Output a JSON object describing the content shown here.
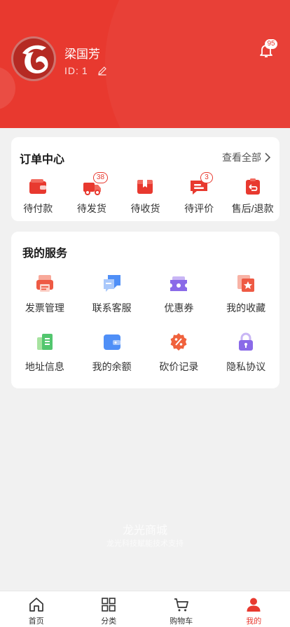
{
  "user": {
    "name": "梁国芳",
    "id_label": "ID:",
    "id_value": "1",
    "notification_count": "95"
  },
  "order_center": {
    "title": "订单中心",
    "view_all": "查看全部",
    "items": [
      {
        "label": "待付款",
        "icon": "wallet-icon",
        "badge": ""
      },
      {
        "label": "待发货",
        "icon": "delivery-truck-icon",
        "badge": "38"
      },
      {
        "label": "待收货",
        "icon": "package-box-icon",
        "badge": ""
      },
      {
        "label": "待评价",
        "icon": "review-message-icon",
        "badge": "3"
      },
      {
        "label": "售后/退款",
        "icon": "refund-clipboard-icon",
        "badge": ""
      }
    ]
  },
  "services": {
    "title": "我的服务",
    "items": [
      {
        "label": "发票管理",
        "icon": "invoice-printer-icon"
      },
      {
        "label": "联系客服",
        "icon": "customer-service-chat-icon"
      },
      {
        "label": "优惠券",
        "icon": "coupon-ticket-icon"
      },
      {
        "label": "我的收藏",
        "icon": "favorites-star-icon"
      },
      {
        "label": "地址信息",
        "icon": "address-document-icon"
      },
      {
        "label": "我的余额",
        "icon": "balance-card-icon"
      },
      {
        "label": "砍价记录",
        "icon": "bargain-percent-icon"
      },
      {
        "label": "隐私协议",
        "icon": "privacy-lock-icon"
      }
    ]
  },
  "watermark": {
    "line1": "龙光商城",
    "line2": "龙光科技赋能技术支持"
  },
  "tabbar": [
    {
      "label": "首页",
      "icon": "home-icon",
      "active": false
    },
    {
      "label": "分类",
      "icon": "category-grid-icon",
      "active": false
    },
    {
      "label": "购物车",
      "icon": "shopping-cart-icon",
      "active": false
    },
    {
      "label": "我的",
      "icon": "user-profile-icon",
      "active": true
    }
  ],
  "colors": {
    "brand_red": "#e8392f",
    "page_background": "#f1f1f1"
  }
}
